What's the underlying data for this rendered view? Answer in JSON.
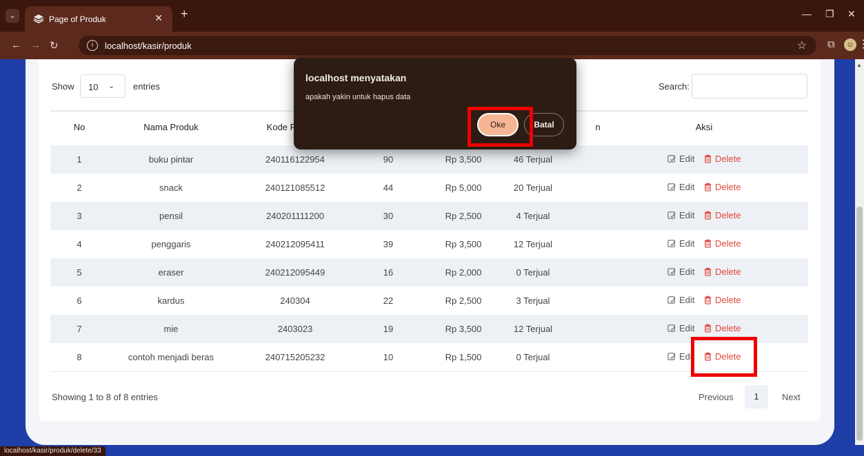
{
  "browser": {
    "tab_title": "Page of Produk",
    "url": "localhost/kasir/produk",
    "status_url": "localhost/kasir/produk/delete/33"
  },
  "table_controls": {
    "show_label": "Show",
    "entries_value": "10",
    "entries_label": "entries",
    "search_label": "Search:",
    "search_value": ""
  },
  "columns": [
    "No",
    "Nama Produk",
    "Kode P",
    "n",
    "Aksi"
  ],
  "rows": [
    {
      "no": "1",
      "nama": "buku pintar",
      "kode": "240116122954",
      "stok": "90",
      "harga": "Rp 3,500",
      "terjual": "46 Terjual"
    },
    {
      "no": "2",
      "nama": "snack",
      "kode": "240121085512",
      "stok": "44",
      "harga": "Rp 5,000",
      "terjual": "20 Terjual"
    },
    {
      "no": "3",
      "nama": "pensil",
      "kode": "240201111200",
      "stok": "30",
      "harga": "Rp 2,500",
      "terjual": "4 Terjual"
    },
    {
      "no": "4",
      "nama": "penggaris",
      "kode": "240212095411",
      "stok": "39",
      "harga": "Rp 3,500",
      "terjual": "12 Terjual"
    },
    {
      "no": "5",
      "nama": "eraser",
      "kode": "240212095449",
      "stok": "16",
      "harga": "Rp 2,000",
      "terjual": "0 Terjual"
    },
    {
      "no": "6",
      "nama": "kardus",
      "kode": "240304",
      "stok": "22",
      "harga": "Rp 2,500",
      "terjual": "3 Terjual"
    },
    {
      "no": "7",
      "nama": "mie",
      "kode": "2403023",
      "stok": "19",
      "harga": "Rp 3,500",
      "terjual": "12 Terjual"
    },
    {
      "no": "8",
      "nama": "contoh menjadi beras",
      "kode": "240715205232",
      "stok": "10",
      "harga": "Rp 1,500",
      "terjual": "0 Terjual"
    }
  ],
  "actions": {
    "edit": "Edit",
    "delete": "Delete"
  },
  "footer": {
    "info": "Showing 1 to 8 of 8 entries",
    "previous": "Previous",
    "page": "1",
    "next": "Next"
  },
  "dialog": {
    "title": "localhost menyatakan",
    "message": "apakah yakin untuk hapus data",
    "ok": "Oke",
    "cancel": "Batal"
  },
  "colors": {
    "accent": "#1f3ea8",
    "delete": "#e0473a",
    "highlight": "#ee0000"
  }
}
